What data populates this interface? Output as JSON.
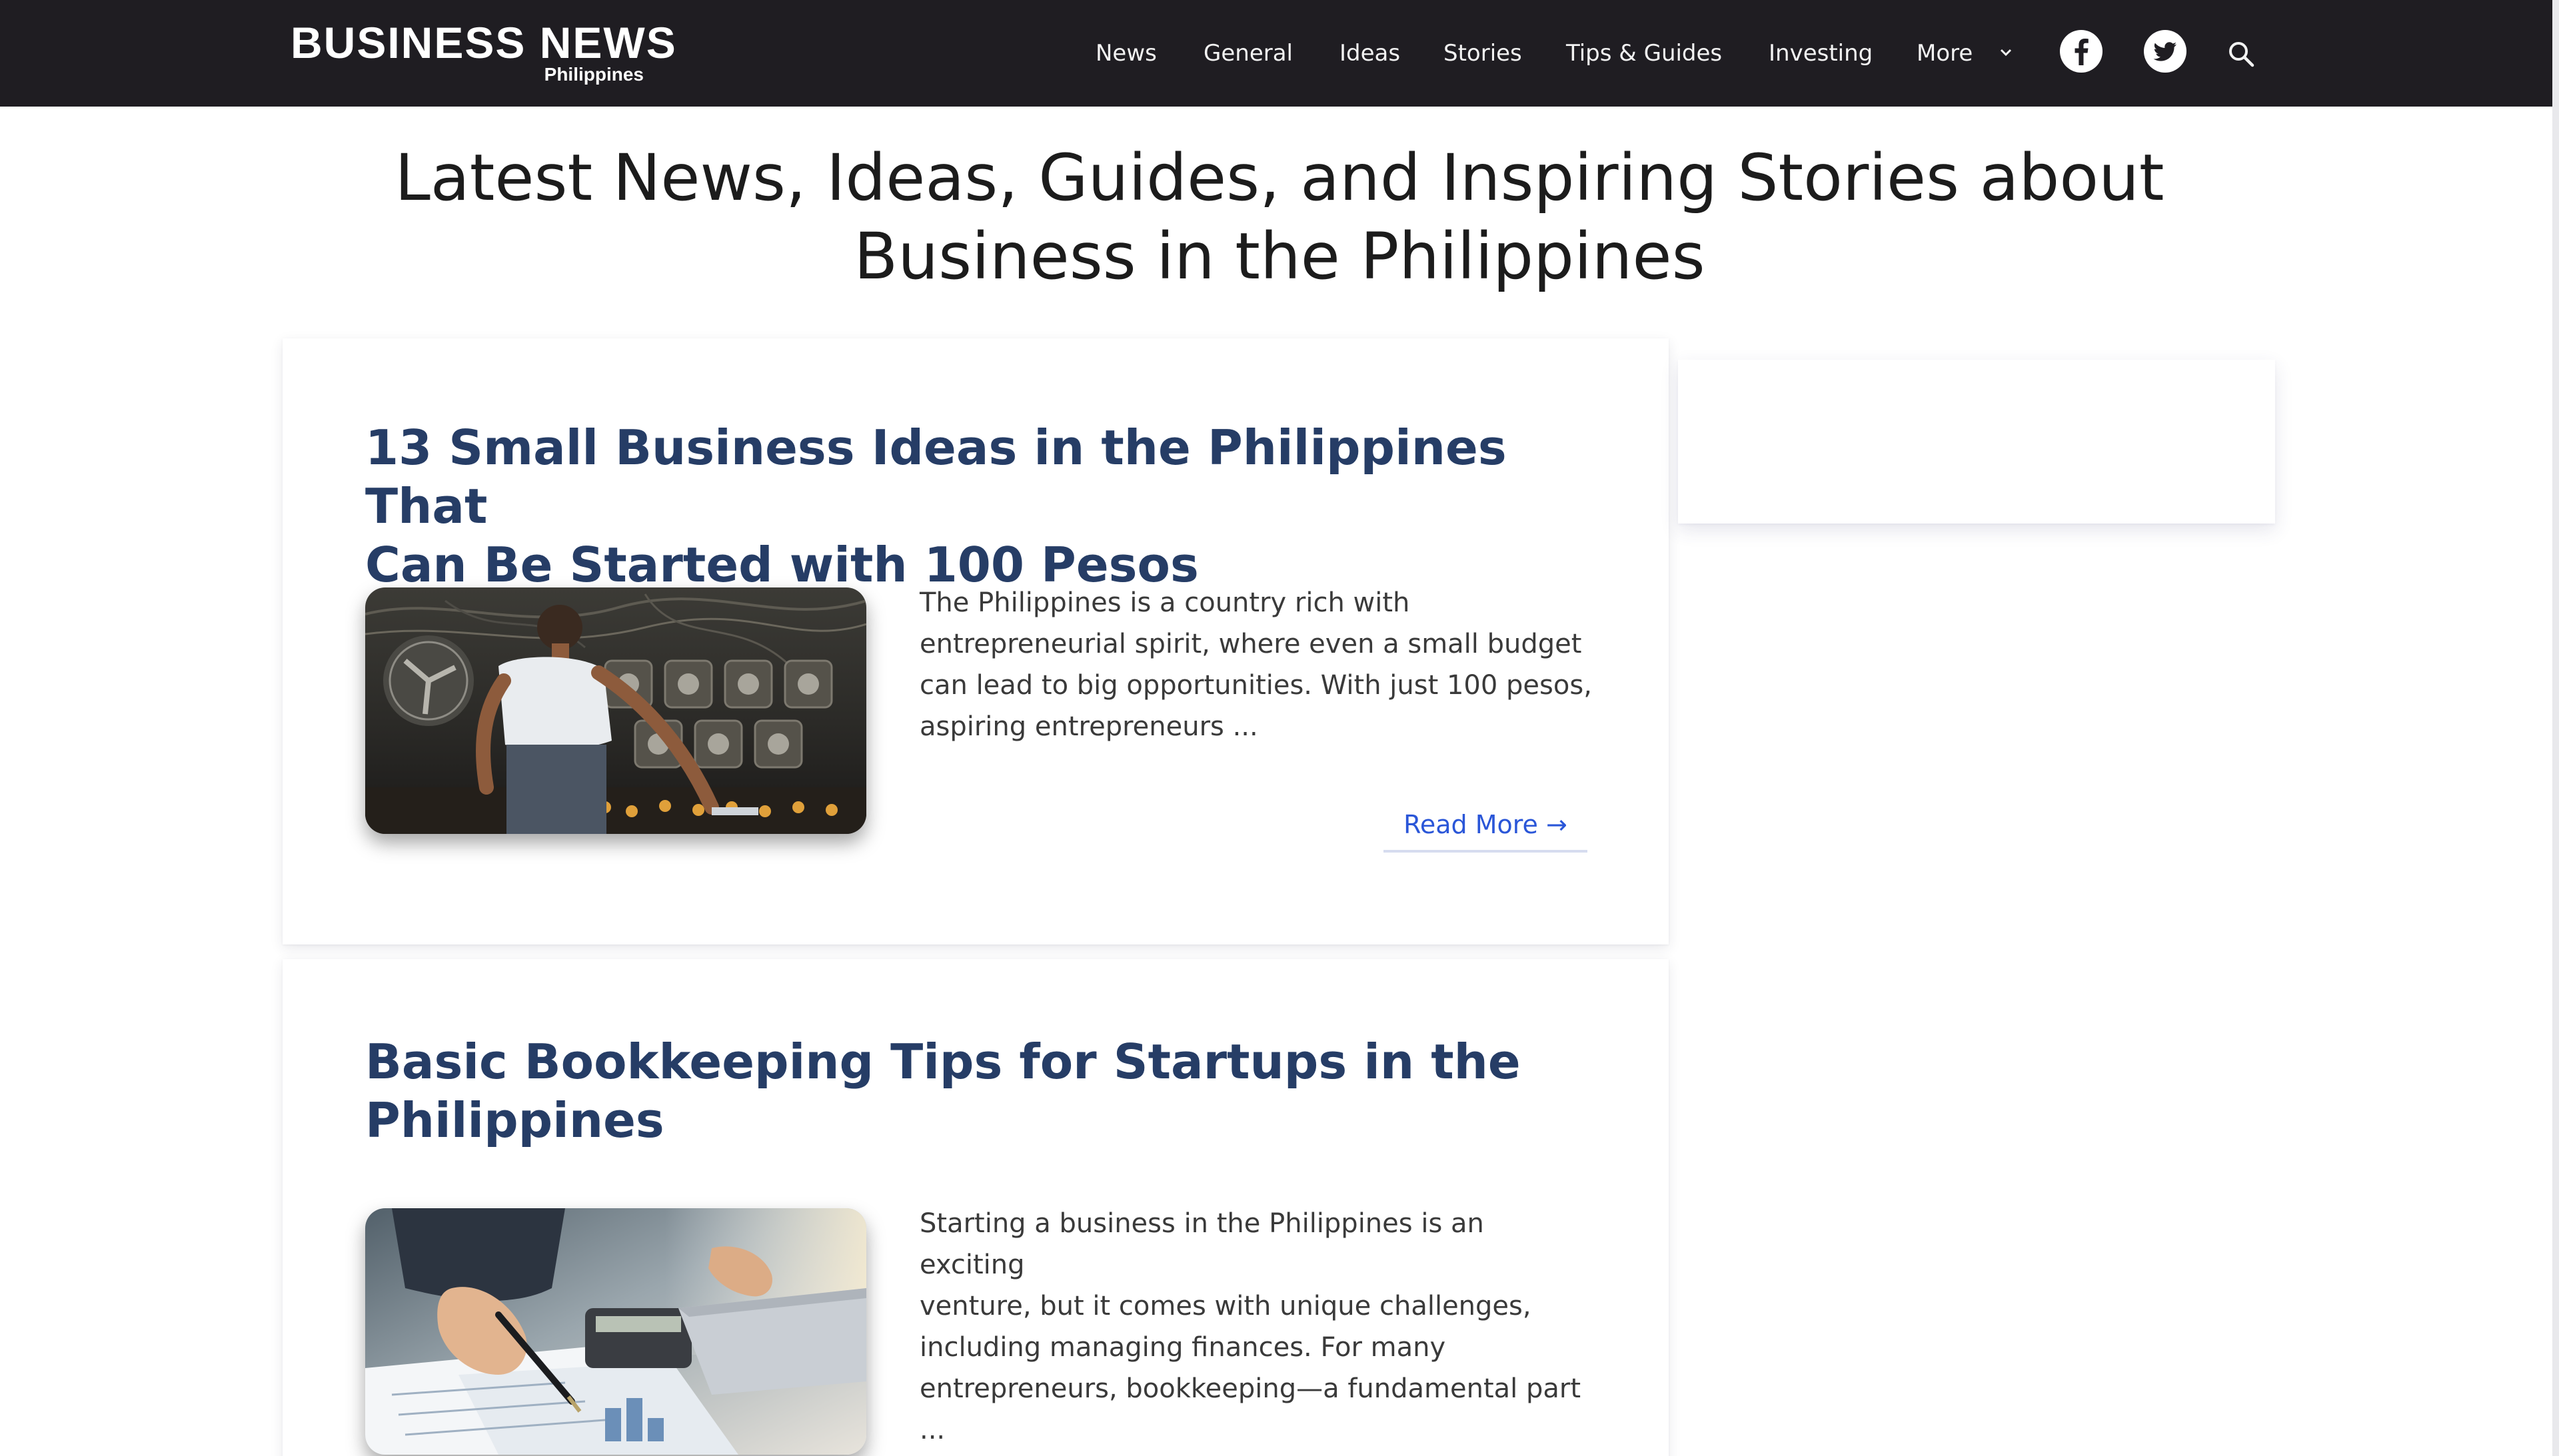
{
  "site": {
    "logo_main": "BUSINESS NEWS",
    "logo_sub": "Philippines"
  },
  "nav": {
    "items": [
      "News",
      "General",
      "Ideas",
      "Stories",
      "Tips & Guides",
      "Investing"
    ],
    "more_label": "More",
    "icons": [
      "facebook-icon",
      "twitter-icon",
      "search-icon"
    ]
  },
  "hero": {
    "title_line1": "Latest News, Ideas, Guides, and Inspiring Stories about",
    "title_line2": "Business in the Philippines"
  },
  "articles": [
    {
      "title_line1": "13 Small Business Ideas in the Philippines That",
      "title_line2": "Can Be Started with 100 Pesos",
      "excerpt_lines": [
        "The Philippines is a country rich with",
        "entrepreneurial spirit, where even a small budget",
        "can lead to big opportunities. With just 100 pesos,",
        "aspiring entrepreneurs ..."
      ],
      "read_more": "Read More →"
    },
    {
      "title_line1": "Basic Bookkeeping Tips for Startups in the",
      "title_line2": "Philippines",
      "excerpt_lines": [
        "Starting a business in the Philippines is an exciting",
        "venture, but it comes with unique challenges,",
        "including managing finances. For many",
        "entrepreneurs, bookkeeping—a fundamental part",
        "..."
      ]
    }
  ],
  "colors": {
    "header_bg": "#1f1d22",
    "title_blue": "#263d66",
    "link_blue": "#2a56d8"
  }
}
